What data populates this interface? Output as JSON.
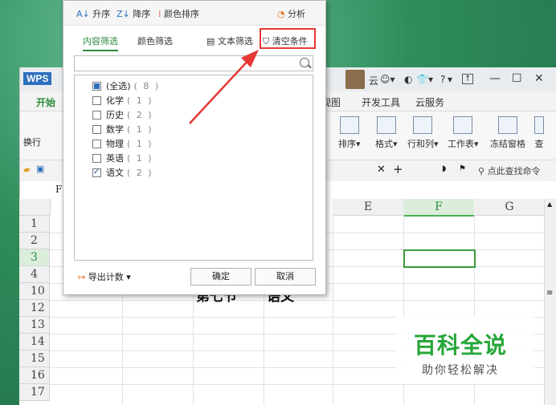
{
  "window": {
    "app_name": "WPS",
    "title_user": "云",
    "help": "?",
    "ribbon_tabs": [
      "开始",
      "视图",
      "开发工具",
      "云服务"
    ],
    "ribbon_items": [
      "排序",
      "格式",
      "行和列",
      "工作表",
      "冻结窗格",
      "查"
    ],
    "left_labels": [
      "换行"
    ],
    "cmd_search": "点此查找命令",
    "formula_ref": "F",
    "accent": "#2b8a3e"
  },
  "sheet": {
    "columns": [
      "E",
      "F",
      "G"
    ],
    "rows": [
      "1",
      "2",
      "3",
      "4",
      "10",
      "12",
      "13",
      "14",
      "15",
      "16",
      "17"
    ],
    "selected_row": "3",
    "selected_col": "F",
    "cell_text_1": "第七节",
    "cell_text_2": "语文"
  },
  "filter_panel": {
    "sort_asc": "升序",
    "sort_desc": "降序",
    "color_sort": "颜色排序",
    "analyze": "分析",
    "tab_content": "内容筛选",
    "tab_color": "颜色筛选",
    "text_filter": "文本筛选",
    "clear": "清空条件",
    "search_placeholder": "",
    "items": [
      {
        "label": "(全选)",
        "count": "( 8 )",
        "state": "partial"
      },
      {
        "label": "化学",
        "count": "( 1 )",
        "state": "unchecked"
      },
      {
        "label": "历史",
        "count": "( 2 )",
        "state": "unchecked"
      },
      {
        "label": "数学",
        "count": "( 1 )",
        "state": "unchecked"
      },
      {
        "label": "物理",
        "count": "( 1 )",
        "state": "unchecked"
      },
      {
        "label": "英语",
        "count": "( 1 )",
        "state": "unchecked"
      },
      {
        "label": "语文",
        "count": "( 2 )",
        "state": "checked"
      }
    ],
    "export": "导出计数",
    "ok": "确定",
    "cancel": "取消",
    "highlight_color": "#e53935"
  },
  "watermark": {
    "title": "百科全说",
    "subtitle": "助你轻松解决"
  }
}
